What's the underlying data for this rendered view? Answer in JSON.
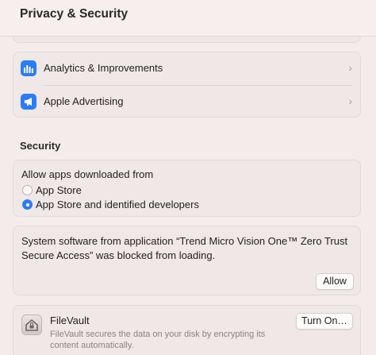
{
  "header": {
    "title": "Privacy & Security"
  },
  "privacy_rows": [
    {
      "label": "Analytics & Improvements",
      "icon": "analytics-chart-icon"
    },
    {
      "label": "Apple Advertising",
      "icon": "megaphone-icon"
    }
  ],
  "security": {
    "section_title": "Security",
    "allow_apps": {
      "label": "Allow apps downloaded from",
      "options": [
        "App Store",
        "App Store and identified developers"
      ],
      "selected": "App Store and identified developers"
    },
    "blocked_message": {
      "text": "System software from application “Trend Micro Vision One™ Zero Trust Secure Access” was blocked from loading.",
      "button": "Allow"
    },
    "filevault": {
      "title": "FileVault",
      "description": "FileVault secures the data on your disk by encrypting its content automatically.",
      "button": "Turn On…",
      "icon": "house-lock-icon"
    }
  },
  "colors": {
    "accent": "#2c7cf5",
    "background": "#f3ecea",
    "panel": "#efe8e6"
  }
}
